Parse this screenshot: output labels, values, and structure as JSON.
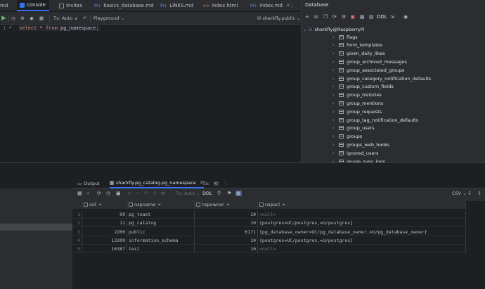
{
  "editor_tabs": [
    {
      "label": "md",
      "color": "#3574f0"
    },
    {
      "label": "console",
      "color": "#3574f0"
    },
    {
      "label": "invites",
      "color": "#6f737a"
    },
    {
      "label": "basics_database.md",
      "color": "#3574f0"
    },
    {
      "label": "LINKS.md",
      "color": "#3574f0"
    },
    {
      "label": "index.html",
      "color": "#e08855"
    },
    {
      "label": "index.md",
      "color": "#3574f0"
    }
  ],
  "editor_tab_icons": {
    "markdown": "M↓",
    "html": "<>"
  },
  "toolbar": {
    "tx_mode": "Tx: Auto",
    "playground": "Playground",
    "schema": "sharkfly.public"
  },
  "editor": {
    "line_number": "1",
    "code_keyword1": "select",
    "code_star": "*",
    "code_keyword2": "from",
    "code_table": "pg_namespace",
    "code_end": ";"
  },
  "database_panel": {
    "title": "Database",
    "ddl_label": "DDL",
    "root": "sharkfly@RaspberryPi",
    "tables": [
      "flags",
      "form_templates",
      "given_daily_likes",
      "group_archived_messages",
      "group_associated_groups",
      "group_category_notification_defaults",
      "group_custom_fields",
      "group_histories",
      "group_mentions",
      "group_requests",
      "group_tag_notification_defaults",
      "group_users",
      "groups",
      "groups_web_hooks",
      "ignored_users",
      "image_sync_logs"
    ]
  },
  "result_tabs": {
    "output": "Output",
    "result": "sharkfly.pg_catalog.pg_namespace",
    "tx": "Tx:"
  },
  "result_toolbar": {
    "tx_mode": "Tx: Auto",
    "ddl": "DDL",
    "export": "CSV"
  },
  "grid": {
    "columns": [
      "oid",
      "nspname",
      "nspowner",
      "nspacl"
    ],
    "rows": [
      {
        "num": "1",
        "oid": "99",
        "nspname": "pg_toast",
        "nspowner": "10",
        "nspacl": "<null>"
      },
      {
        "num": "2",
        "oid": "11",
        "nspname": "pg_catalog",
        "nspowner": "10",
        "nspacl": "{postgres=UC/postgres,=U/postgres}"
      },
      {
        "num": "3",
        "oid": "2200",
        "nspname": "public",
        "nspowner": "6171",
        "nspacl": "{pg_database_owner=UC/pg_database_owner,=U/pg_database_owner}"
      },
      {
        "num": "4",
        "oid": "13209",
        "nspname": "information_schema",
        "nspowner": "10",
        "nspacl": "{postgres=UC/postgres,=U/postgres}"
      },
      {
        "num": "5",
        "oid": "16387",
        "nspname": "test",
        "nspowner": "10",
        "nspacl": "<null>"
      }
    ]
  }
}
